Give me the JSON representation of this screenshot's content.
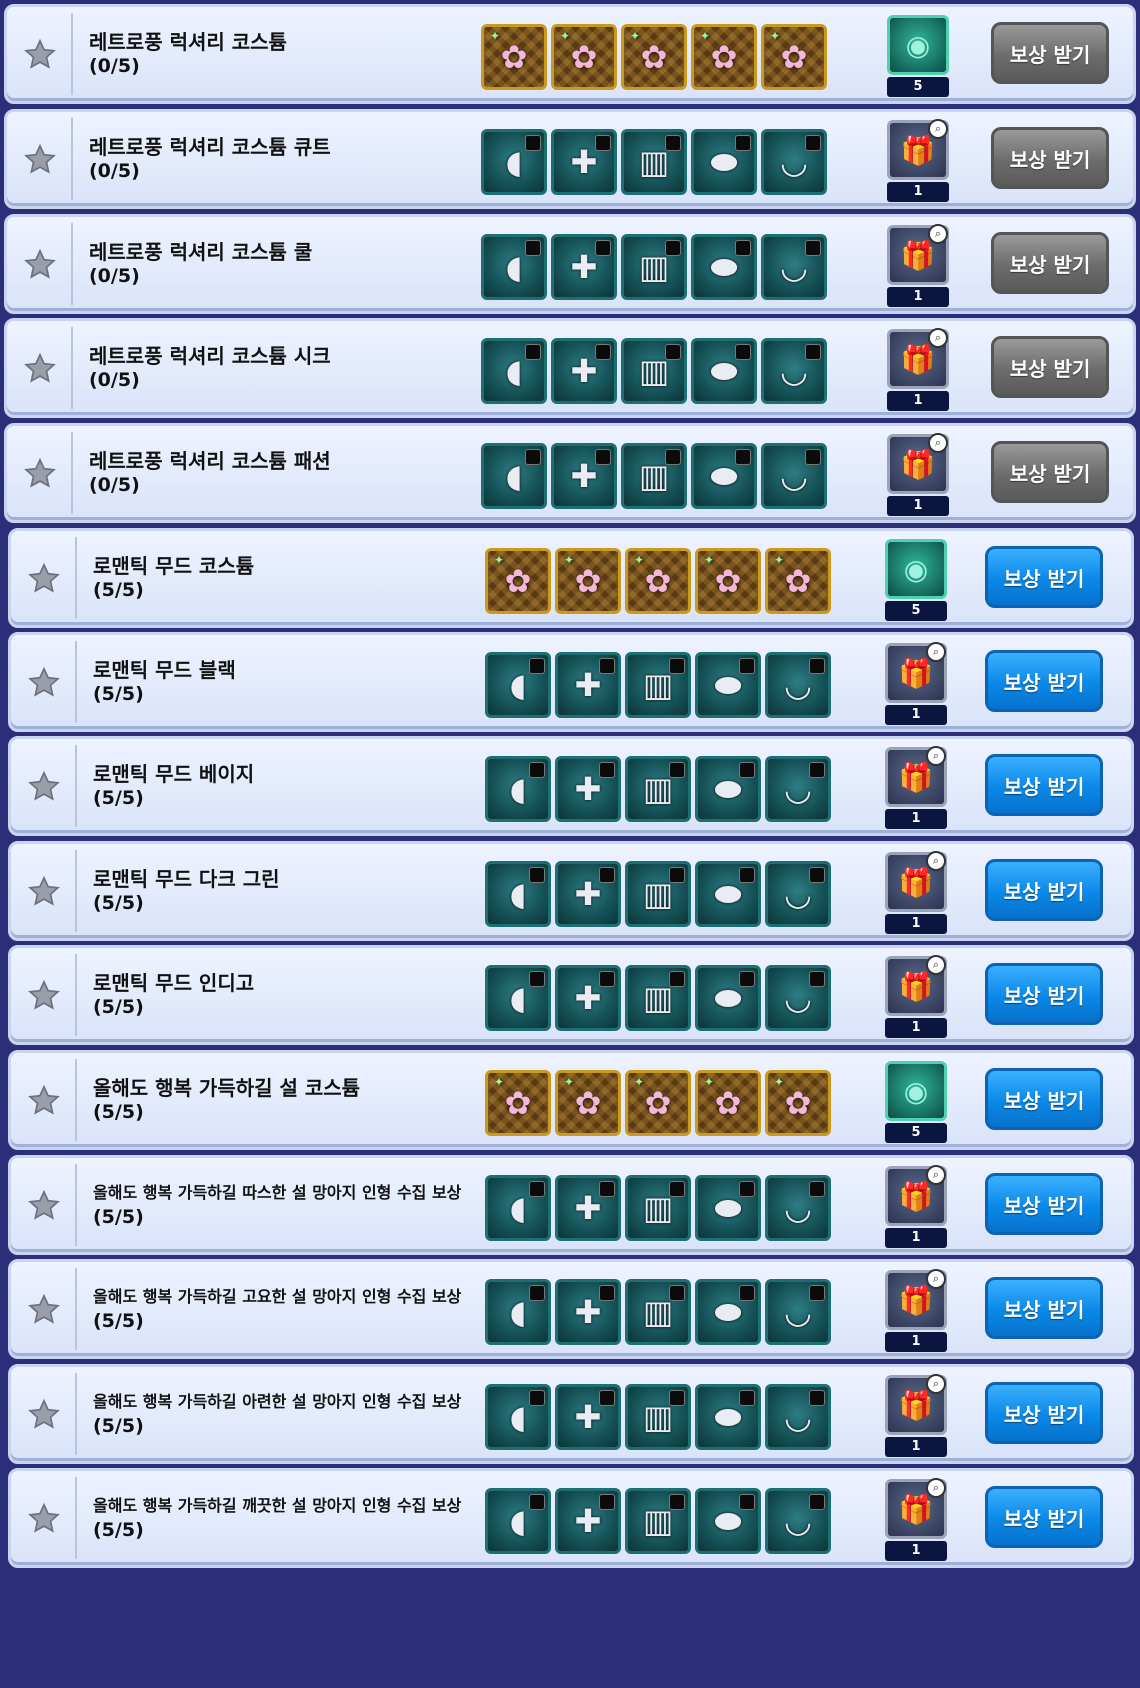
{
  "rows": [
    {
      "title": "레트로풍 럭셔리 코스튬",
      "progress": "(0/5)",
      "reward_count": "5",
      "button": "보상 받기",
      "completed": false,
      "item_style": "gold",
      "reward_type": "gem-sphere"
    },
    {
      "title": "레트로풍 럭셔리 코스튬 큐트",
      "progress": "(0/5)",
      "reward_count": "1",
      "button": "보상 받기",
      "completed": false,
      "item_style": "teal",
      "reward_type": "gift-box"
    },
    {
      "title": "레트로풍 럭셔리 코스튬 쿨",
      "progress": "(0/5)",
      "reward_count": "1",
      "button": "보상 받기",
      "completed": false,
      "item_style": "teal",
      "reward_type": "gift-box"
    },
    {
      "title": "레트로풍 럭셔리 코스튬 시크",
      "progress": "(0/5)",
      "reward_count": "1",
      "button": "보상 받기",
      "completed": false,
      "item_style": "teal",
      "reward_type": "gift-box"
    },
    {
      "title": "레트로풍 럭셔리 코스튬 패션",
      "progress": "(0/5)",
      "reward_count": "1",
      "button": "보상 받기",
      "completed": false,
      "item_style": "teal",
      "reward_type": "gift-box"
    },
    {
      "title": "로맨틱 무드 코스튬",
      "progress": "(5/5)",
      "reward_count": "5",
      "button": "보상 받기",
      "completed": true,
      "item_style": "gold",
      "reward_type": "gem-sphere"
    },
    {
      "title": "로맨틱 무드 블랙",
      "progress": "(5/5)",
      "reward_count": "1",
      "button": "보상 받기",
      "completed": true,
      "item_style": "teal",
      "reward_type": "gift-box"
    },
    {
      "title": "로맨틱 무드 베이지",
      "progress": "(5/5)",
      "reward_count": "1",
      "button": "보상 받기",
      "completed": true,
      "item_style": "teal",
      "reward_type": "gift-box"
    },
    {
      "title": "로맨틱 무드 다크 그린",
      "progress": "(5/5)",
      "reward_count": "1",
      "button": "보상 받기",
      "completed": true,
      "item_style": "teal",
      "reward_type": "gift-box"
    },
    {
      "title": "로맨틱 무드 인디고",
      "progress": "(5/5)",
      "reward_count": "1",
      "button": "보상 받기",
      "completed": true,
      "item_style": "teal",
      "reward_type": "gift-box"
    },
    {
      "title": "올해도 행복 가득하길 설 코스튬",
      "progress": "(5/5)",
      "reward_count": "5",
      "button": "보상 받기",
      "completed": true,
      "item_style": "gold",
      "reward_type": "gem-sphere"
    },
    {
      "title": "올해도 행복 가득하길 따스한 설 망아지 인형 수집 보상",
      "progress": "(5/5)",
      "reward_count": "1",
      "button": "보상 받기",
      "completed": true,
      "item_style": "teal",
      "reward_type": "gift-box"
    },
    {
      "title": "올해도 행복 가득하길 고요한 설 망아지 인형 수집 보상",
      "progress": "(5/5)",
      "reward_count": "1",
      "button": "보상 받기",
      "completed": true,
      "item_style": "teal",
      "reward_type": "gift-box"
    },
    {
      "title": "올해도 행복 가득하길 아련한 설 망아지 인형 수집 보상",
      "progress": "(5/5)",
      "reward_count": "1",
      "button": "보상 받기",
      "completed": true,
      "item_style": "teal",
      "reward_type": "gift-box"
    },
    {
      "title": "올해도 행복 가득하길 깨끗한 설 망아지 인형 수집 보상",
      "progress": "(5/5)",
      "reward_count": "1",
      "button": "보상 받기",
      "completed": true,
      "item_style": "teal",
      "reward_type": "gift-box"
    }
  ],
  "item_icons_gold": [
    "accessory-icon",
    "accessory-icon",
    "accessory-icon",
    "accessory-icon",
    "accessory-icon"
  ],
  "item_icons_teal": [
    "hair-icon",
    "top-icon",
    "bottom-icon",
    "shoes-icon",
    "accessory-icon"
  ],
  "colors": {
    "claim_gray": "#6c6c6c",
    "claim_blue": "#0a88e8",
    "item_teal": "#145055",
    "item_gold": "#5a3a14"
  }
}
